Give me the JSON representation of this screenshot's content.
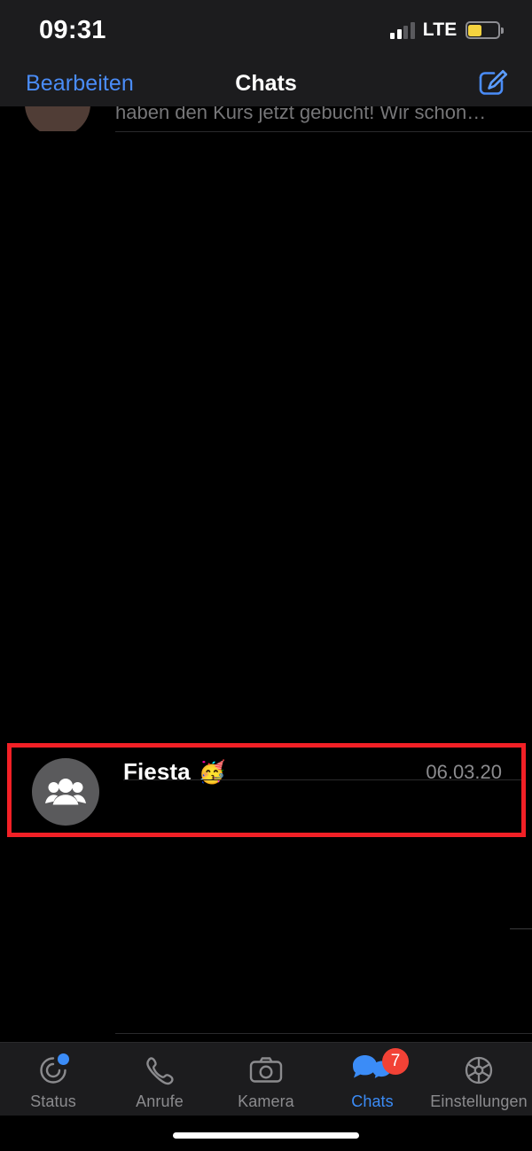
{
  "status_bar": {
    "time": "09:31",
    "network_label": "LTE",
    "signal_bars_filled": 2,
    "signal_bars_total": 4,
    "battery_color": "#f5d33f",
    "battery_level_pct": 40
  },
  "nav_bar": {
    "edit_label": "Bearbeiten",
    "title": "Chats",
    "compose_icon": "compose-icon",
    "accent_color": "#4a8cf7"
  },
  "chat_list": {
    "clipped_row": {
      "preview": "haben den Kurs jetzt gebucht! Wir schon…"
    },
    "highlighted_row": {
      "avatar_icon": "group-avatar-icon",
      "title": "Fiesta",
      "emoji": "🥳",
      "date": "06.03.20",
      "highlight_color": "#f22026"
    }
  },
  "tab_bar": {
    "items": [
      {
        "label": "Status",
        "icon": "status-rings-icon",
        "active": false,
        "dot": true,
        "badge": ""
      },
      {
        "label": "Anrufe",
        "icon": "phone-icon",
        "active": false,
        "dot": false,
        "badge": ""
      },
      {
        "label": "Kamera",
        "icon": "camera-icon",
        "active": false,
        "dot": false,
        "badge": ""
      },
      {
        "label": "Chats",
        "icon": "chat-bubbles-icon",
        "active": true,
        "dot": false,
        "badge": "7"
      },
      {
        "label": "Einstellungen",
        "icon": "gear-icon",
        "active": false,
        "dot": false,
        "badge": ""
      }
    ],
    "active_color": "#3b8cf7",
    "badge_color": "#f24236"
  }
}
